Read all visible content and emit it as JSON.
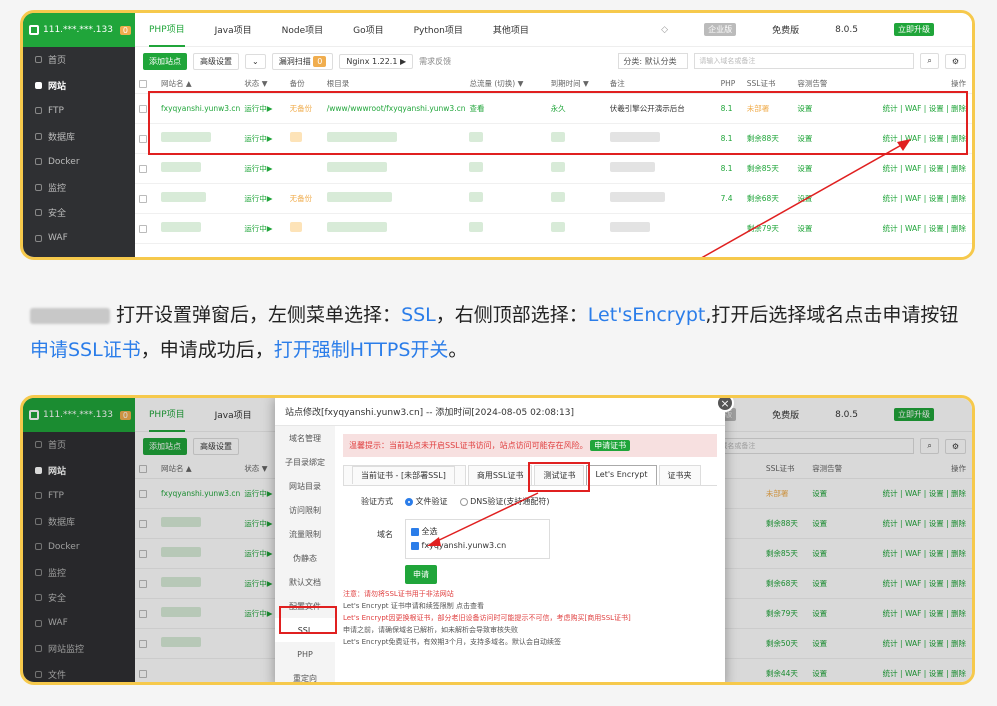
{
  "top": {
    "server_ip": "111.***.***.133",
    "server_count": "0",
    "sidebar": [
      "首页",
      "网站",
      "FTP",
      "数据库",
      "Docker",
      "监控",
      "安全",
      "WAF"
    ],
    "tabs": [
      "PHP项目",
      "Java项目",
      "Node项目",
      "Go项目",
      "Python项目",
      "其他项目"
    ],
    "edition": "企业版",
    "free_label": "免费版",
    "version": "8.0.5",
    "upgrade": "立即升级",
    "toolbar": {
      "add": "添加站点",
      "advanced": "高级设置",
      "scan": "漏洞扫描",
      "scan_count": "0",
      "nginx": "Nginx 1.22.1 ▶",
      "feedback": "需求反馈",
      "category": "分类: 默认分类",
      "search_placeholder": "请输入域名或备注"
    },
    "columns": [
      "网站名 ▲",
      "状态 ▼",
      "备份",
      "根目录",
      "总流量 (切换) ▼",
      "到期时间 ▼",
      "备注",
      "PHP",
      "SSL证书",
      "容测告警",
      "操作"
    ],
    "row1": {
      "name": "fxyqyanshi.yunw3.cn",
      "status": "运行中▶",
      "backup": "无备份",
      "root": "/www/wwwroot/fxyqyanshi.yunw3.cn",
      "traffic": "查看",
      "expire": "永久",
      "remark": "伏羲引擎公开演示后台",
      "php": "8.1",
      "ssl": "未部署",
      "alarm": "设置",
      "ops": "统计 | WAF | 设置 | 删除"
    },
    "rows": [
      {
        "status": "运行中▶",
        "php": "8.1",
        "ssl": "剩余88天",
        "alarm": "设置",
        "ops": "统计 | WAF | 设置 | 删除"
      },
      {
        "status": "运行中▶",
        "php": "8.1",
        "ssl": "剩余85天",
        "alarm": "设置",
        "ops": "统计 | WAF | 设置 | 删除"
      },
      {
        "status": "运行中▶",
        "php": "7.4",
        "ssl": "剩余68天",
        "alarm": "设置",
        "ops": "统计 | WAF | 设置 | 删除",
        "backup": "无备份"
      },
      {
        "status": "运行中▶",
        "php": "",
        "ssl": "剩余79天",
        "alarm": "设置",
        "ops": "统计 | WAF | 设置 | 删除"
      }
    ]
  },
  "caption": {
    "p1": "打开设置弹窗后，左侧菜单选择：",
    "ssl": "SSL",
    "p2": "，右侧顶部选择：",
    "le": "Let'sEncrypt",
    "p3": ",打开后选择域名点击申请按钮",
    "apply": "申请SSL证书",
    "p4": "，申请成功后，",
    "force": "打开强制HTTPS开关",
    "p5": "。"
  },
  "bottom": {
    "server_ip": "111.***.***.133",
    "server_count": "0",
    "sidebar": [
      "首页",
      "网站",
      "FTP",
      "数据库",
      "Docker",
      "监控",
      "安全",
      "WAF",
      "网站监控",
      "文件"
    ],
    "modal_title": "站点修改[fxyqyanshi.yunw3.cn] -- 添加时间[2024-08-05 02:08:13]",
    "menu": [
      "域名管理",
      "子目录绑定",
      "网站目录",
      "访问限制",
      "流量限制",
      "伪静态",
      "默认文档",
      "配置文件",
      "SSL",
      "PHP",
      "重定向"
    ],
    "warn": "温馨提示：当前站点未开启SSL证书访问，站点访问可能存在风险。",
    "warn_btn": "申请证书",
    "ssl_tabs": [
      "当前证书 - [未部署SSL]",
      "商用SSL证书",
      "测试证书",
      "Let's Encrypt",
      "证书夹"
    ],
    "verify_label": "验证方式",
    "verify_file": "文件验证",
    "verify_dns": "DNS验证(支持通配符)",
    "domain_label": "域名",
    "select_all": "全选",
    "domain": "fxyqyanshi.yunw3.cn",
    "apply_btn": "申请",
    "notes": [
      "注意：请勿将SSL证书用于非法网站",
      "Let's Encrypt 证书申请和续签限制 点击查看",
      "Let's Encrypt因更换根证书，部分老旧设备访问时可能提示不可信，考虑购买[商用SSL证书]",
      "申请之前，请确保域名已解析，如未解析会导致审核失败",
      "Let's Encrypt免费证书，有效期3个月，支持多域名。默认会自动续签"
    ],
    "right_cols": [
      "SSL证书",
      "容测告警",
      "操作"
    ],
    "right_rows": [
      {
        "ssl": "未部署",
        "alarm": "设置",
        "ops": "统计 | WAF | 设置 | 删除"
      },
      {
        "ssl": "剩余88天",
        "alarm": "设置",
        "ops": "统计 | WAF | 设置 | 删除"
      },
      {
        "ssl": "剩余85天",
        "alarm": "设置",
        "ops": "统计 | WAF | 设置 | 删除"
      },
      {
        "ssl": "剩余68天",
        "alarm": "设置",
        "ops": "统计 | WAF | 设置 | 删除"
      },
      {
        "ssl": "剩余79天",
        "alarm": "设置",
        "ops": "统计 | WAF | 设置 | 删除"
      },
      {
        "ssl": "剩余50天",
        "alarm": "设置",
        "ops": "统计 | WAF | 设置 | 删除"
      },
      {
        "ssl": "剩余44天",
        "alarm": "设置",
        "ops": "统计 | WAF | 设置 | 删除"
      }
    ]
  }
}
